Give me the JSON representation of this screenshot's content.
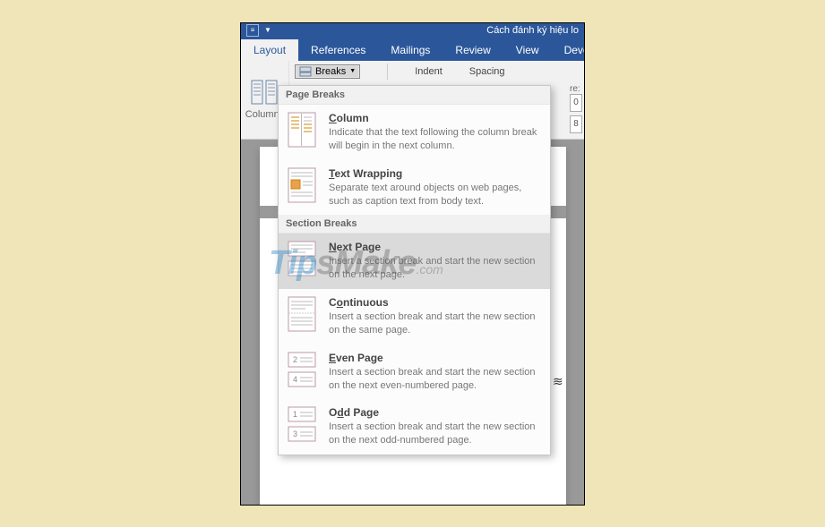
{
  "title_bar": {
    "doc_name": "Cách đánh ký hiệu lo"
  },
  "tabs": {
    "layout": "Layout",
    "references": "References",
    "mailings": "Mailings",
    "review": "Review",
    "view": "View",
    "developer": "Deve"
  },
  "ribbon": {
    "columns_label": "Columns",
    "breaks_label": "Breaks",
    "indent_label": "Indent",
    "spacing_label": "Spacing",
    "right_field_top": "0",
    "right_field_bottom": "8",
    "right_cut_label": "re:"
  },
  "breaks_menu": {
    "section_page": "Page Breaks",
    "section_section": "Section Breaks",
    "column": {
      "title_pre": "",
      "title_u": "C",
      "title_post": "olumn",
      "desc": "Indicate that the text following the column break will begin in the next column."
    },
    "text_wrapping": {
      "title_pre": "",
      "title_u": "T",
      "title_post": "ext Wrapping",
      "desc": "Separate text around objects on web pages, such as caption text from body text."
    },
    "next_page": {
      "title_pre": "",
      "title_u": "N",
      "title_post": "ext Page",
      "desc": "Insert a section break and start the new section on the next page."
    },
    "continuous": {
      "title_pre": "C",
      "title_u": "o",
      "title_post": "ntinuous",
      "desc": "Insert a section break and start the new section on the same page."
    },
    "even_page": {
      "title_pre": "",
      "title_u": "E",
      "title_post": "ven Page",
      "desc": "Insert a section break and start the new section on the next even-numbered page."
    },
    "odd_page": {
      "title_pre": "O",
      "title_u": "d",
      "title_post": "d Page",
      "desc": "Insert a section break and start the new section on the next odd-numbered page."
    }
  },
  "watermark": {
    "tip": "Tip",
    "make": "sMake",
    "com": ".com"
  }
}
